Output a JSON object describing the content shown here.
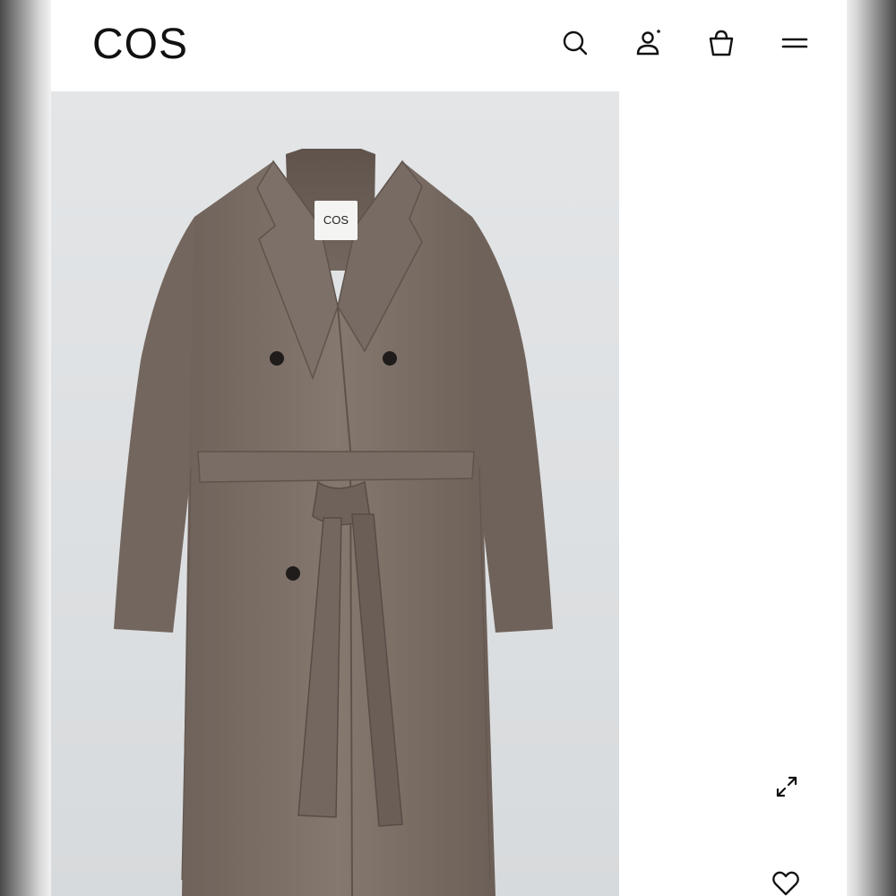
{
  "header": {
    "brand": "COS",
    "icons": [
      "search-icon",
      "account-icon",
      "bag-icon",
      "menu-icon"
    ]
  },
  "product": {
    "garment_label": "COS",
    "image_icons": [
      "expand-icon",
      "heart-icon"
    ]
  },
  "colors": {
    "coat": "#7e7169",
    "background": "#dfe1e3",
    "text": "#111111"
  }
}
